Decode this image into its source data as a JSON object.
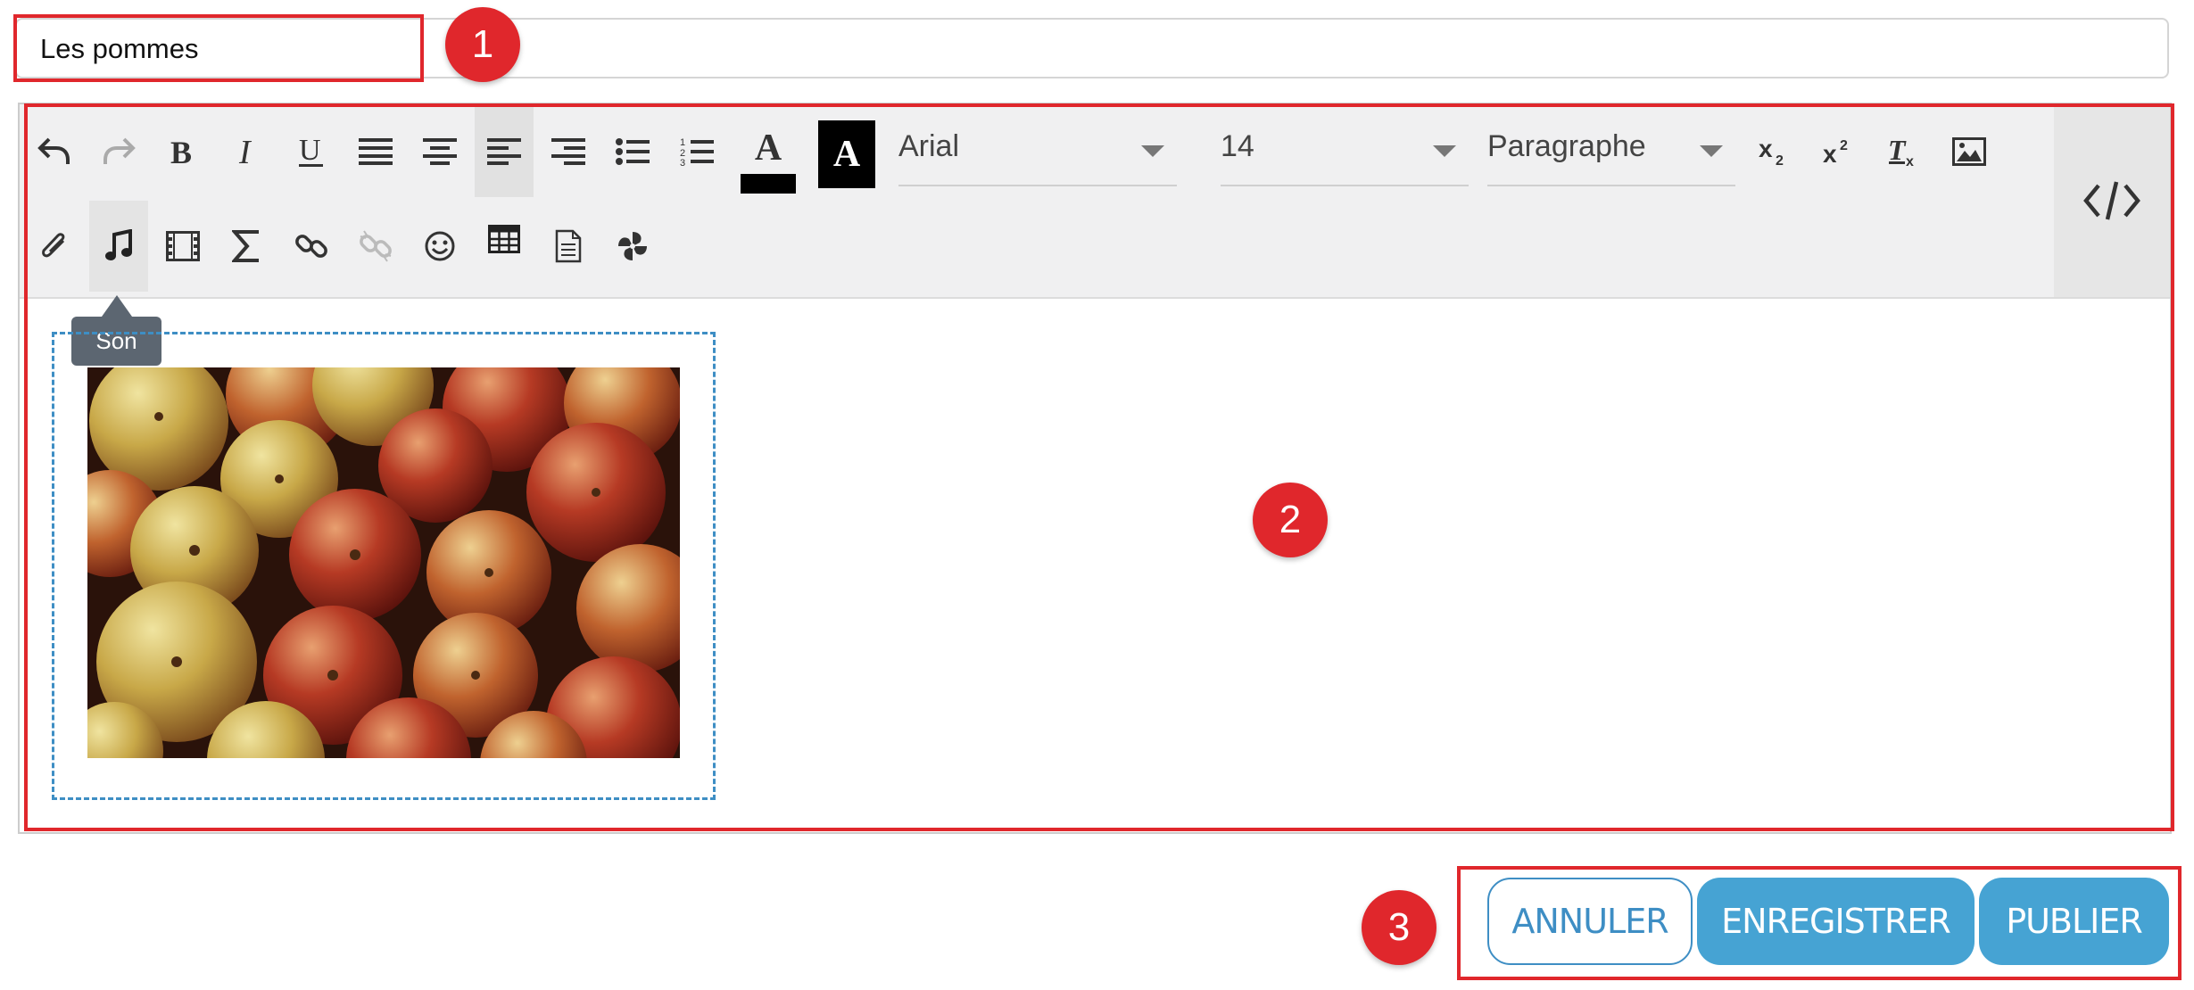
{
  "title_field": {
    "value": "Les pommes"
  },
  "toolbar": {
    "font_family": "Arial",
    "font_size": "14",
    "block_format": "Paragraphe",
    "text_color_label": "A",
    "highlight_color_label": "A",
    "icons_row1": [
      "undo-icon",
      "redo-icon",
      "bold-icon",
      "italic-icon",
      "underline-icon",
      "justify-icon",
      "align-center-icon",
      "align-left-icon",
      "align-right-icon",
      "bullet-list-icon",
      "numbered-list-icon",
      "text-color-icon",
      "background-color-icon",
      "subscript-icon",
      "superscript-icon",
      "clear-format-icon",
      "image-icon",
      "code-view-icon"
    ],
    "icons_row2": [
      "attachment-icon",
      "music-icon",
      "video-icon",
      "sigma-icon",
      "link-icon",
      "unlink-icon",
      "emoji-icon",
      "table-icon",
      "document-icon",
      "spinner-icon"
    ]
  },
  "tooltip": {
    "label": "Son"
  },
  "buttons": {
    "cancel": "ANNULER",
    "save": "ENREGISTRER",
    "publish": "PUBLIER"
  },
  "annotations": {
    "badge1": "1",
    "badge2": "2",
    "badge3": "3",
    "color": "#e0272c"
  },
  "colors": {
    "accent": "#46a3d3",
    "accent_outline": "#3e8ec4",
    "toolbar_bg": "#f0f0f1"
  }
}
